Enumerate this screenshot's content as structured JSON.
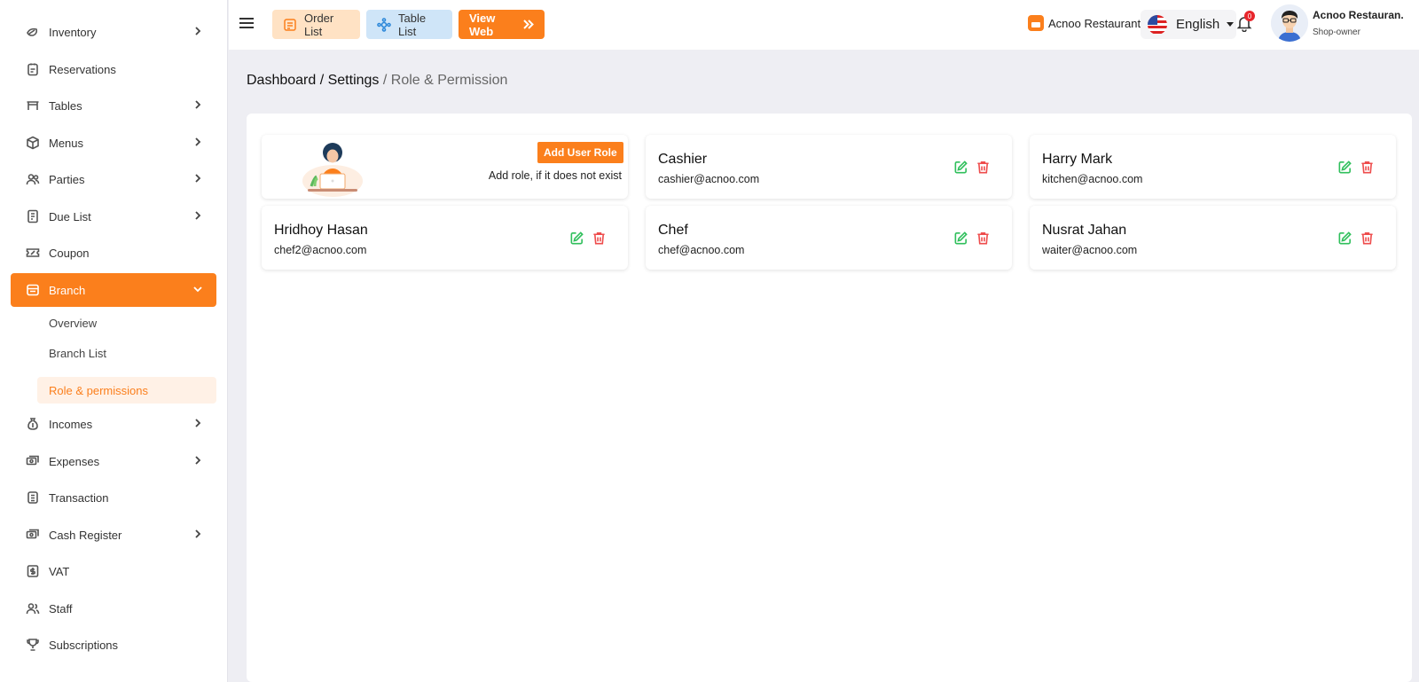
{
  "sidebar": {
    "items": [
      {
        "label": "Inventory",
        "icon": "inventory-icon",
        "has_children": true
      },
      {
        "label": "Reservations",
        "icon": "reservation-icon",
        "has_children": false
      },
      {
        "label": "Tables",
        "icon": "table-icon",
        "has_children": true
      },
      {
        "label": "Menus",
        "icon": "menu-icon",
        "has_children": true
      },
      {
        "label": "Parties",
        "icon": "parties-icon",
        "has_children": true
      },
      {
        "label": "Due List",
        "icon": "due-list-icon",
        "has_children": true
      },
      {
        "label": "Coupon",
        "icon": "coupon-icon",
        "has_children": false
      },
      {
        "label": "Branch",
        "icon": "branch-icon",
        "has_children": true,
        "expanded": true,
        "active": true
      },
      {
        "label": "Incomes",
        "icon": "income-icon",
        "has_children": true
      },
      {
        "label": "Expenses",
        "icon": "expense-icon",
        "has_children": true
      },
      {
        "label": "Transaction",
        "icon": "transaction-icon",
        "has_children": false
      },
      {
        "label": "Cash Register",
        "icon": "cash-register-icon",
        "has_children": true
      },
      {
        "label": "VAT",
        "icon": "vat-icon",
        "has_children": false
      },
      {
        "label": "Staff",
        "icon": "staff-icon",
        "has_children": false
      },
      {
        "label": "Subscriptions",
        "icon": "subscription-icon",
        "has_children": false
      }
    ],
    "branch_sub": [
      {
        "label": "Overview"
      },
      {
        "label": "Branch List"
      },
      {
        "label": "Role & permissions",
        "active": true
      }
    ]
  },
  "topbar": {
    "order_list": "Order List",
    "table_list": "Table List",
    "view_web": "View Web",
    "restaurant": "Acnoo Restaurant",
    "language": "English",
    "notification_count": "0",
    "user_name": "Acnoo Restauran.",
    "user_role": "Shop-owner"
  },
  "breadcrumb": {
    "part1": "Dashboard / Settings",
    "part2": " / Role & Permission"
  },
  "add_role": {
    "button": "Add User Role",
    "note": "Add role, if it does not exist"
  },
  "roles": [
    {
      "name": "Cashier",
      "email": "cashier@acnoo.com"
    },
    {
      "name": "Harry Mark",
      "email": "kitchen@acnoo.com"
    },
    {
      "name": "Hridhoy Hasan",
      "email": "chef2@acnoo.com"
    },
    {
      "name": "Chef",
      "email": "chef@acnoo.com"
    },
    {
      "name": "Nusrat Jahan",
      "email": "waiter@acnoo.com"
    }
  ],
  "colors": {
    "accent": "#fb7f1c",
    "edit": "#2fbf5b",
    "delete": "#ee4c4c",
    "order_btn_bg": "#ffe2c4",
    "table_btn_bg": "#cfe5f8"
  }
}
